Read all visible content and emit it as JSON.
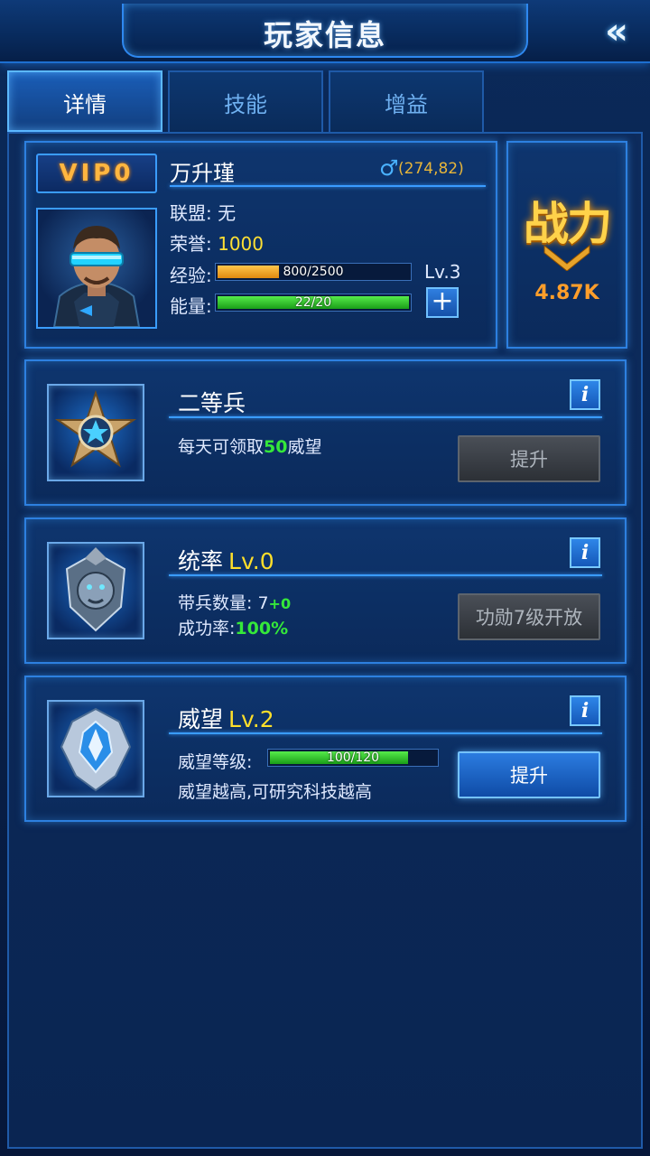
{
  "header": {
    "title": "玩家信息",
    "back_icon": "double-chevron-left-icon"
  },
  "tabs": [
    {
      "label": "详情",
      "active": true
    },
    {
      "label": "技能",
      "active": false
    },
    {
      "label": "增益",
      "active": false
    }
  ],
  "profile": {
    "vip": "VIP0",
    "name": "万升瑾",
    "gender_icon": "male-icon",
    "coords": "(274,82)",
    "alliance_label": "联盟: ",
    "alliance_value": "无",
    "honor_label": "荣誉: ",
    "honor_value": "1000",
    "exp_label": "经验:",
    "exp_text": "800/2500",
    "exp_fraction": 0.32,
    "level": "Lv.3",
    "energy_label": "能量:",
    "energy_text": "22/20",
    "energy_fraction": 1.0,
    "plus_label": "+"
  },
  "power": {
    "label": "战力",
    "value": "4.87K"
  },
  "cards": [
    {
      "title": "二等兵",
      "level": "",
      "icon": "rank-star-medal-icon",
      "line1_prefix": "每天可领取",
      "line1_highlight": "50",
      "line1_suffix": "威望",
      "button": "提升",
      "button_style": "gray"
    },
    {
      "title": "统率",
      "level": "Lv.0",
      "icon": "command-lion-crest-icon",
      "line1_prefix": "带兵数量: ",
      "line1_value": "7",
      "line1_highlight": "+0",
      "line2_prefix": "成功率:",
      "line2_highlight": "100%",
      "button": "功勋7级开放",
      "button_style": "gray"
    },
    {
      "title": "威望",
      "level": "Lv.2",
      "icon": "prestige-crest-icon",
      "line1_prefix": "威望等级:",
      "bar_text": "100/120",
      "bar_fraction": 0.833,
      "line2_prefix": "威望越高,可研究科技越高",
      "button": "提升",
      "button_style": "blue"
    }
  ],
  "colors": {
    "accent": "#3a9cff",
    "gold": "#ffd24a",
    "green": "#35e83a",
    "yellow": "#ffe033"
  }
}
